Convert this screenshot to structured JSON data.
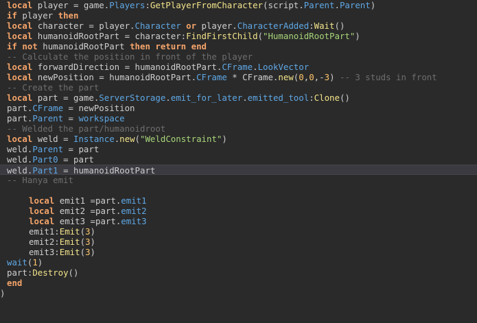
{
  "editor": {
    "language": "Lua",
    "current_line": 16,
    "lines": [
      [
        [
          "kw",
          "local"
        ],
        [
          "id",
          " player = game."
        ],
        [
          "mem",
          "Players"
        ],
        [
          "id",
          ":"
        ],
        [
          "fn",
          "GetPlayerFromCharacter"
        ],
        [
          "id",
          "(script."
        ],
        [
          "mem",
          "Parent"
        ],
        [
          "id",
          "."
        ],
        [
          "mem",
          "Parent"
        ],
        [
          "id",
          ")"
        ]
      ],
      [
        [
          "kw",
          "if"
        ],
        [
          "id",
          " player "
        ],
        [
          "kw",
          "then"
        ]
      ],
      [
        [
          "kw",
          "local"
        ],
        [
          "id",
          " character = player."
        ],
        [
          "mem",
          "Character"
        ],
        [
          "id",
          " "
        ],
        [
          "kw",
          "or"
        ],
        [
          "id",
          " player."
        ],
        [
          "mem",
          "CharacterAdded"
        ],
        [
          "id",
          ":"
        ],
        [
          "fn",
          "Wait"
        ],
        [
          "id",
          "()"
        ]
      ],
      [
        [
          "kw",
          "local"
        ],
        [
          "id",
          " humanoidRootPart = character:"
        ],
        [
          "fn",
          "FindFirstChild"
        ],
        [
          "id",
          "("
        ],
        [
          "str",
          "\"HumanoidRootPart\""
        ],
        [
          "id",
          ")"
        ]
      ],
      [
        [
          "kw",
          "if"
        ],
        [
          "id",
          " "
        ],
        [
          "kw",
          "not"
        ],
        [
          "id",
          " humanoidRootPart "
        ],
        [
          "kw",
          "then"
        ],
        [
          "id",
          " "
        ],
        [
          "kw",
          "return"
        ],
        [
          "id",
          " "
        ],
        [
          "kw",
          "end"
        ]
      ],
      [
        [
          "cm",
          "-- Calculate the position in front of the player"
        ]
      ],
      [
        [
          "kw",
          "local"
        ],
        [
          "id",
          " forwardDirection = humanoidRootPart."
        ],
        [
          "mem",
          "CFrame"
        ],
        [
          "id",
          "."
        ],
        [
          "mem",
          "LookVector"
        ]
      ],
      [
        [
          "kw",
          "local"
        ],
        [
          "id",
          " newPosition = humanoidRootPart."
        ],
        [
          "mem",
          "CFrame"
        ],
        [
          "id",
          " * CFrame."
        ],
        [
          "fn",
          "new"
        ],
        [
          "id",
          "("
        ],
        [
          "num",
          "0"
        ],
        [
          "id",
          ","
        ],
        [
          "num",
          "0"
        ],
        [
          "id",
          ",-"
        ],
        [
          "num",
          "3"
        ],
        [
          "id",
          ") "
        ],
        [
          "cm",
          "-- 3 studs in front"
        ]
      ],
      [
        [
          "cm",
          "-- Create the part"
        ]
      ],
      [
        [
          "kw",
          "local"
        ],
        [
          "id",
          " part = game."
        ],
        [
          "mem",
          "ServerStorage"
        ],
        [
          "id",
          "."
        ],
        [
          "mem",
          "emit_for_later"
        ],
        [
          "id",
          "."
        ],
        [
          "mem",
          "emitted_tool"
        ],
        [
          "id",
          ":"
        ],
        [
          "fn",
          "Clone"
        ],
        [
          "id",
          "()"
        ]
      ],
      [
        [
          "id",
          "part."
        ],
        [
          "mem",
          "CFrame"
        ],
        [
          "id",
          " = newPosition"
        ]
      ],
      [
        [
          "id",
          "part."
        ],
        [
          "mem",
          "Parent"
        ],
        [
          "id",
          " = "
        ],
        [
          "mem",
          "workspace"
        ]
      ],
      [
        [
          "cm",
          "-- Welded the part/humanoidroot"
        ]
      ],
      [
        [
          "kw",
          "local"
        ],
        [
          "id",
          " weld = "
        ],
        [
          "mem",
          "Instance"
        ],
        [
          "id",
          "."
        ],
        [
          "fn",
          "new"
        ],
        [
          "id",
          "("
        ],
        [
          "str",
          "\"WeldConstraint\""
        ],
        [
          "id",
          ")"
        ]
      ],
      [
        [
          "id",
          "weld."
        ],
        [
          "mem",
          "Parent"
        ],
        [
          "id",
          " = part"
        ]
      ],
      [
        [
          "id",
          "weld."
        ],
        [
          "mem",
          "Part0"
        ],
        [
          "id",
          " = part"
        ]
      ],
      [
        [
          "id",
          "weld."
        ],
        [
          "mem",
          "Part1"
        ],
        [
          "id",
          " = humanoidRootPart"
        ]
      ],
      [
        [
          "cm",
          "-- Hanya emit"
        ]
      ],
      [],
      [
        [
          "ind",
          ""
        ],
        [
          "kw",
          "local"
        ],
        [
          "id",
          " emit1 =part."
        ],
        [
          "mem",
          "emit1"
        ]
      ],
      [
        [
          "ind",
          ""
        ],
        [
          "kw",
          "local"
        ],
        [
          "id",
          " emit2 =part."
        ],
        [
          "mem",
          "emit2"
        ]
      ],
      [
        [
          "ind",
          ""
        ],
        [
          "kw",
          "local"
        ],
        [
          "id",
          " emit3 =part."
        ],
        [
          "mem",
          "emit3"
        ]
      ],
      [
        [
          "ind",
          ""
        ],
        [
          "id",
          "emit1:"
        ],
        [
          "fn",
          "Emit"
        ],
        [
          "id",
          "("
        ],
        [
          "num",
          "3"
        ],
        [
          "id",
          ")"
        ]
      ],
      [
        [
          "ind",
          ""
        ],
        [
          "id",
          "emit2:"
        ],
        [
          "fn",
          "Emit"
        ],
        [
          "id",
          "("
        ],
        [
          "num",
          "3"
        ],
        [
          "id",
          ")"
        ]
      ],
      [
        [
          "ind",
          ""
        ],
        [
          "id",
          "emit3:"
        ],
        [
          "fn",
          "Emit"
        ],
        [
          "id",
          "("
        ],
        [
          "num",
          "3"
        ],
        [
          "id",
          ")"
        ]
      ],
      [
        [
          "mem",
          "wait"
        ],
        [
          "id",
          "("
        ],
        [
          "num",
          "1"
        ],
        [
          "id",
          ")"
        ]
      ],
      [
        [
          "id",
          "part:"
        ],
        [
          "fn",
          "Destroy"
        ],
        [
          "id",
          "()"
        ]
      ],
      [
        [
          "kw",
          "end"
        ]
      ],
      [
        [
          "id",
          ")"
        ]
      ]
    ]
  }
}
